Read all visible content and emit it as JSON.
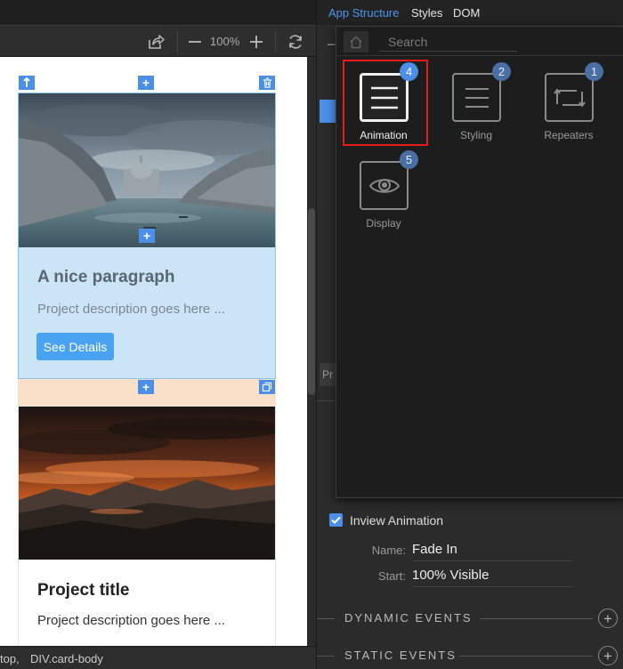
{
  "toolbar": {
    "zoom": "100%"
  },
  "canvas": {
    "card1": {
      "title": "A nice paragraph",
      "description": "Project description goes here ...",
      "button_label": "See Details"
    },
    "card2": {
      "title": "Project title",
      "description": "Project description goes here ..."
    }
  },
  "statusbar": {
    "crumb_prev": "top,",
    "crumb_current": "DIV.card-body"
  },
  "panel": {
    "tabs": [
      {
        "label": "App Structure",
        "active": true
      },
      {
        "label": "Styles",
        "active": false
      },
      {
        "label": "DOM",
        "active": false
      }
    ],
    "partial_label": "Pr"
  },
  "popup": {
    "search_placeholder": "Search",
    "categories": [
      {
        "label": "Animation",
        "count": "4",
        "icon": "menu-lines-icon",
        "selected": true
      },
      {
        "label": "Styling",
        "count": "2",
        "icon": "menu-lines-icon",
        "selected": false
      },
      {
        "label": "Repeaters",
        "count": "1",
        "icon": "repeat-arrows-icon",
        "selected": false
      },
      {
        "label": "Display",
        "count": "5",
        "icon": "eye-icon",
        "selected": false
      }
    ]
  },
  "animation": {
    "inview_label": "Inview Animation",
    "inview_checked": true,
    "name_label": "Name:",
    "name_value": "Fade In",
    "start_label": "Start:",
    "start_value": "100% Visible"
  },
  "sections": {
    "dynamic_events": "DYNAMIC EVENTS",
    "static_events": "STATIC EVENTS"
  },
  "colors": {
    "accent": "#4c8fe8",
    "selection_highlight": "#e31b1b",
    "card_selected_bg": "#cbe5f7",
    "margin_highlight": "#fae0c8"
  }
}
